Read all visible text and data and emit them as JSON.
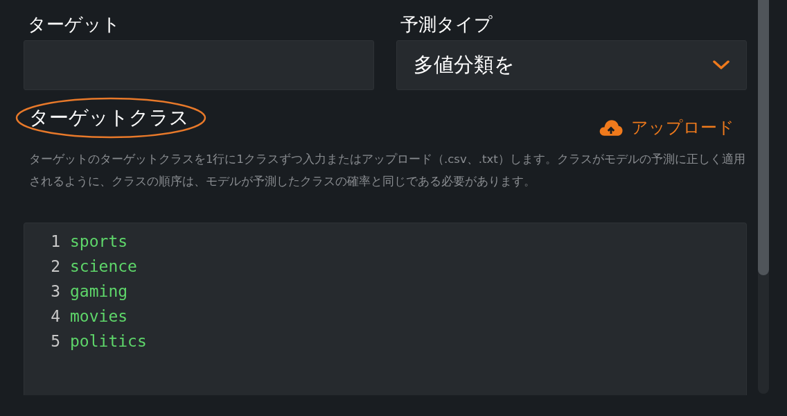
{
  "target": {
    "label": "ターゲット"
  },
  "prediction_type": {
    "label": "予測タイプ",
    "value": "多値分類を"
  },
  "target_class": {
    "label": "ターゲットクラス",
    "circled": true,
    "upload_button": "アップロード",
    "help": "ターゲットのターゲットクラスを1行に1クラスずつ入力またはアップロード（.csv、.txt）します。クラスがモデルの予測に正しく適用されるように、クラスの順序は、モデルが予測したクラスの確率と同じである必要があります。",
    "editor": {
      "lines": [
        {
          "number": "1",
          "text": "sports"
        },
        {
          "number": "2",
          "text": "science"
        },
        {
          "number": "3",
          "text": "gaming"
        },
        {
          "number": "4",
          "text": "movies"
        },
        {
          "number": "5",
          "text": "politics"
        }
      ]
    }
  }
}
